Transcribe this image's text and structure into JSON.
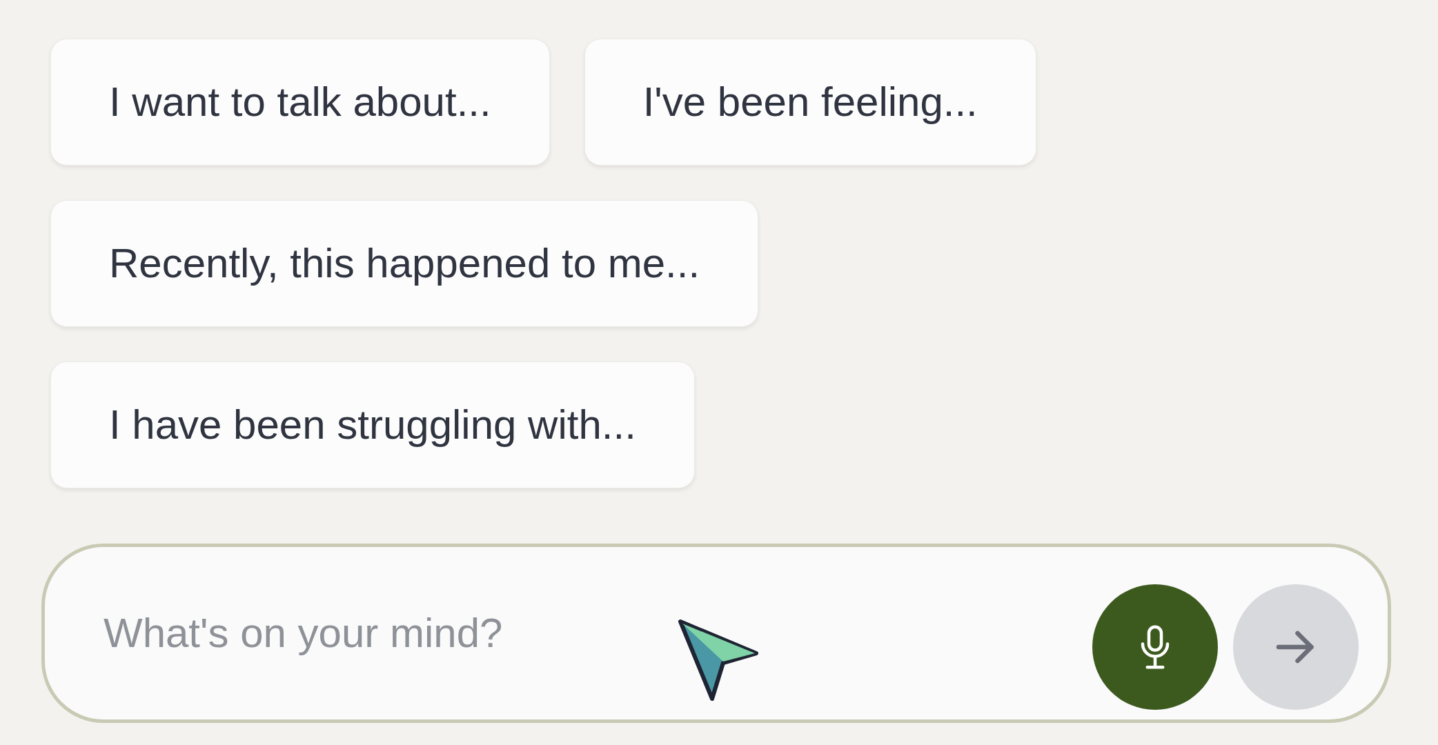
{
  "suggestion_rows": [
    {
      "suggestions": [
        "I want to talk about...",
        "I've been feeling..."
      ]
    },
    {
      "suggestions": [
        "Recently, this happened to me..."
      ]
    },
    {
      "suggestions": [
        "I have been struggling with..."
      ]
    }
  ],
  "message_input": {
    "placeholder": "What's on your mind?"
  },
  "send_button": {
    "disabled": true
  }
}
